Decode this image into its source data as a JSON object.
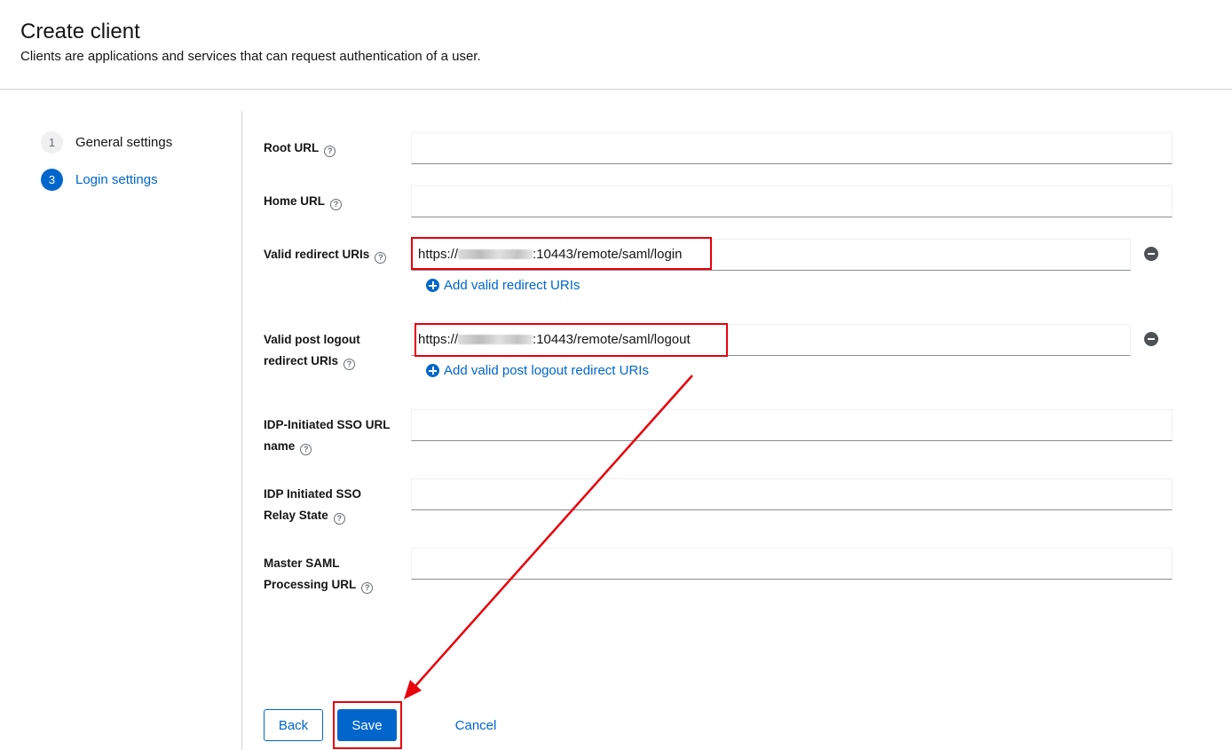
{
  "header": {
    "title": "Create client",
    "subtitle": "Clients are applications and services that can request authentication of a user."
  },
  "wizard": {
    "steps": [
      {
        "number": "1",
        "label": "General settings",
        "active": false
      },
      {
        "number": "3",
        "label": "Login settings",
        "active": true
      }
    ]
  },
  "form": {
    "root_url": {
      "label": "Root URL",
      "value": ""
    },
    "home_url": {
      "label": "Home URL",
      "value": ""
    },
    "valid_redirect_uris": {
      "label": "Valid redirect URIs",
      "value_prefix": "https://",
      "value_suffix": ":10443/remote/saml/login",
      "add_label": "Add valid redirect URIs"
    },
    "valid_post_logout": {
      "label_line1": "Valid post logout",
      "label_line2": "redirect URIs",
      "value_prefix": "https://",
      "value_suffix": ":10443/remote/saml/logout",
      "add_label": "Add valid post logout redirect URIs"
    },
    "idp_sso_url_name": {
      "label_line1": "IDP-Initiated SSO URL",
      "label_line2": "name",
      "value": ""
    },
    "idp_relay_state": {
      "label_line1": "IDP Initiated SSO",
      "label_line2": "Relay State",
      "value": ""
    },
    "master_saml_url": {
      "label_line1": "Master SAML",
      "label_line2": "Processing URL",
      "value": ""
    },
    "help_glyph": "?"
  },
  "actions": {
    "back": "Back",
    "save": "Save",
    "cancel": "Cancel"
  },
  "annotation_color": "#e8000b",
  "accent_color": "#0066cc"
}
